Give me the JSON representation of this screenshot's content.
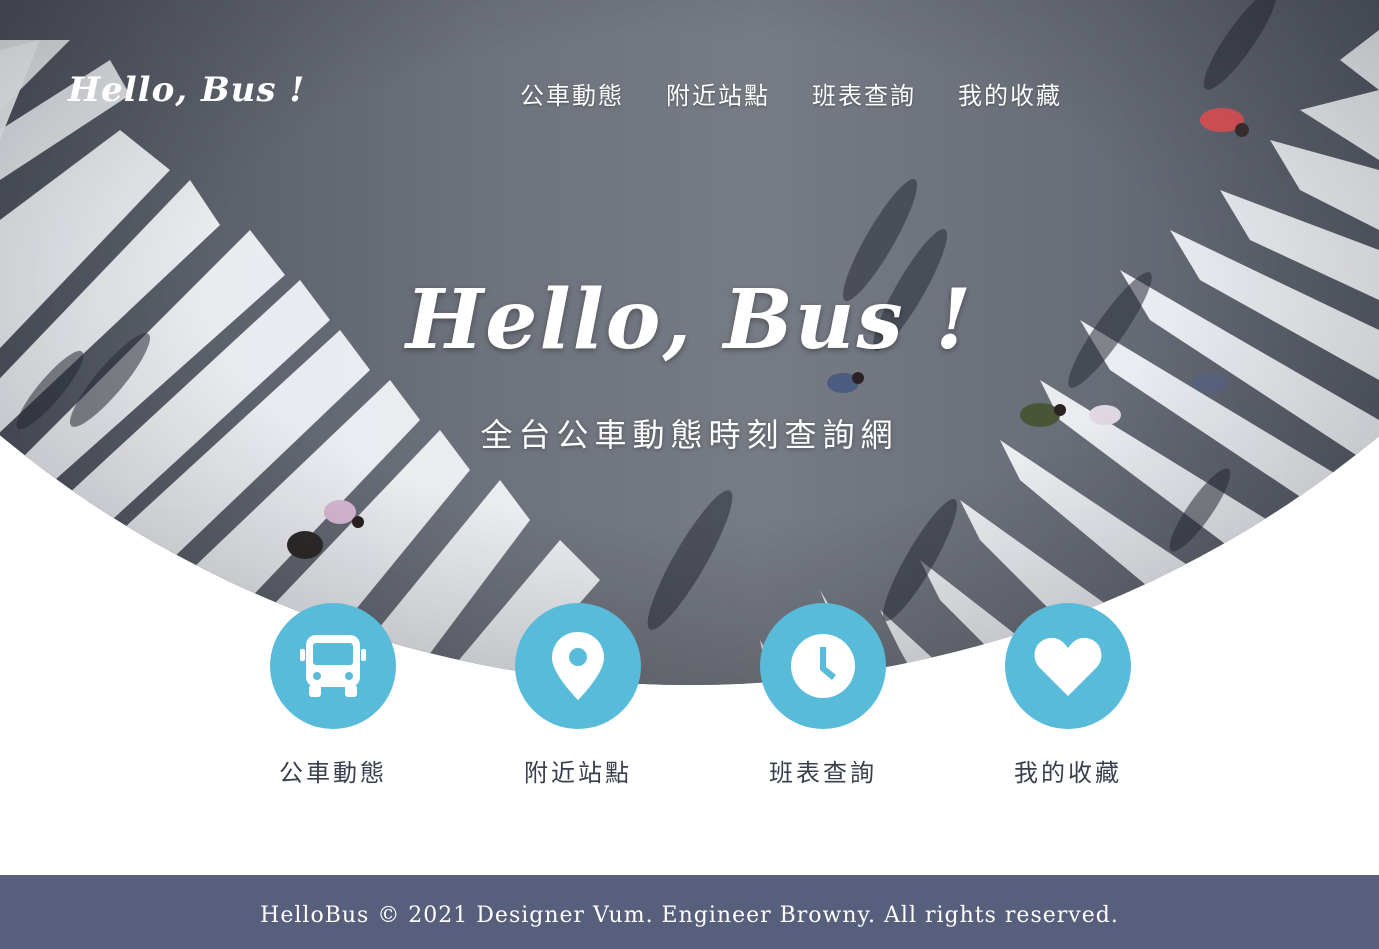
{
  "header": {
    "logo": "Hello, Bus !",
    "nav": [
      "公車動態",
      "附近站點",
      "班表查詢",
      "我的收藏"
    ]
  },
  "hero": {
    "title": "Hello, Bus !",
    "subtitle": "全台公車動態時刻查詢網"
  },
  "features": [
    {
      "label": "公車動態",
      "icon": "bus-icon"
    },
    {
      "label": "附近站點",
      "icon": "map-pin-icon"
    },
    {
      "label": "班表查詢",
      "icon": "clock-icon"
    },
    {
      "label": "我的收藏",
      "icon": "heart-icon"
    }
  ],
  "footer": {
    "text": "HelloBus © 2021 Designer Vum. Engineer Browny. All rights reserved."
  },
  "colors": {
    "accent": "#58bbda",
    "footer_bg": "#575f7d",
    "label_text": "#3a3f4d"
  }
}
